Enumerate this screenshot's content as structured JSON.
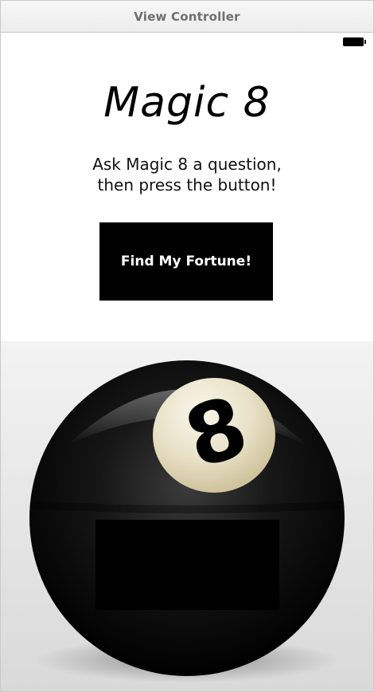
{
  "window": {
    "title": "View Controller"
  },
  "status_bar": {
    "battery_icon": "battery-icon"
  },
  "app": {
    "title": "Magic 8",
    "instructions_line1": "Ask Magic 8 a question,",
    "instructions_line2": "then press the button!",
    "button_label": "Find My Fortune!",
    "ball_number": "8",
    "answer_text": ""
  },
  "colors": {
    "background": "#ffffff",
    "button": "#000000",
    "ball": "#111111",
    "ball_label": "#efe7cf"
  }
}
